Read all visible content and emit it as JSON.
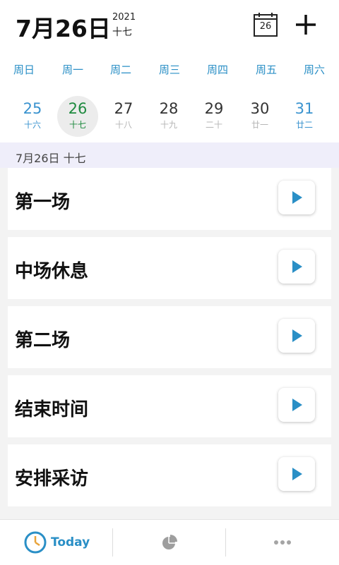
{
  "header": {
    "date": "7月26日",
    "year": "2021",
    "lunar": "十七",
    "calendar_day": "26"
  },
  "weekdays": [
    "周日",
    "周一",
    "周二",
    "周三",
    "周四",
    "周五",
    "周六"
  ],
  "days": [
    {
      "num": "25",
      "lunar": "十六"
    },
    {
      "num": "26",
      "lunar": "十七"
    },
    {
      "num": "27",
      "lunar": "十八"
    },
    {
      "num": "28",
      "lunar": "十九"
    },
    {
      "num": "29",
      "lunar": "二十"
    },
    {
      "num": "30",
      "lunar": "廿一"
    },
    {
      "num": "31",
      "lunar": "廿二"
    }
  ],
  "section": {
    "label": "7月26日 十七"
  },
  "items": [
    {
      "title": "第一场"
    },
    {
      "title": "中场休息"
    },
    {
      "title": "第二场"
    },
    {
      "title": "结束时间"
    },
    {
      "title": "安排采访"
    }
  ],
  "tabbar": {
    "today_label": "Today"
  },
  "colors": {
    "accent": "#2a8fc6",
    "selected_day": "#1e8a3f"
  }
}
